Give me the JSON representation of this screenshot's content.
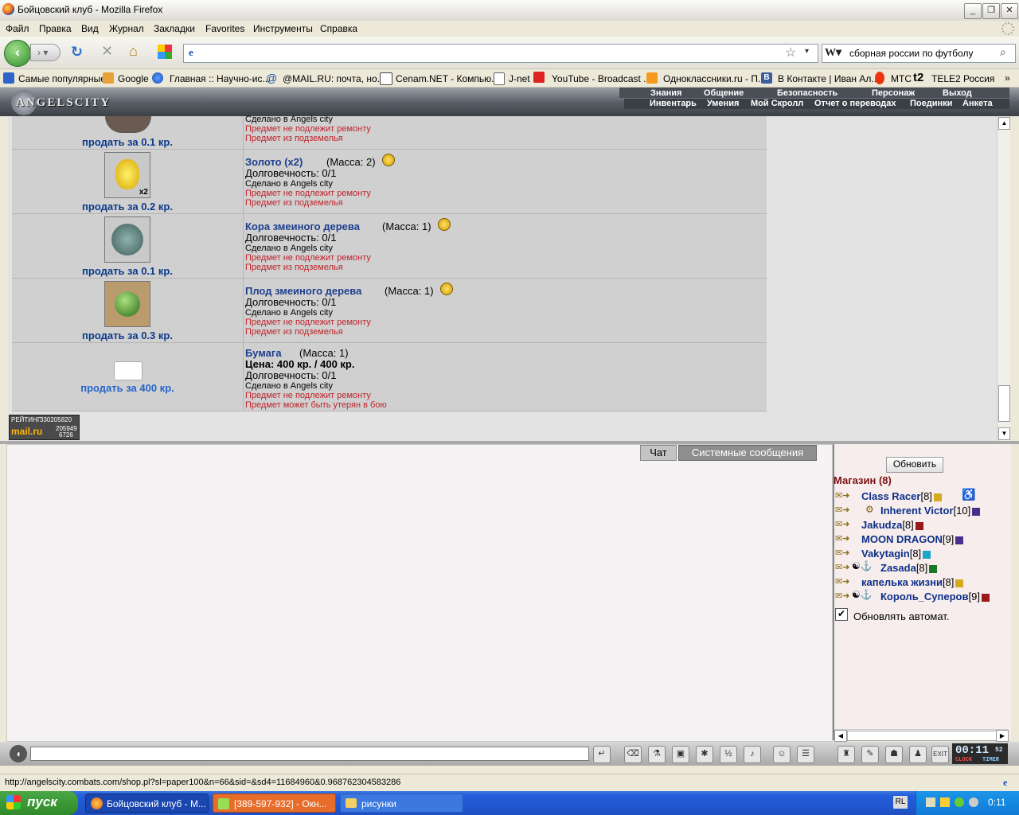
{
  "window": {
    "title": "Бойцовский клуб - Mozilla Firefox"
  },
  "menu": [
    "Файл",
    "Правка",
    "Вид",
    "Журнал",
    "Закладки",
    "Favorites",
    "Инструменты",
    "Справка"
  ],
  "search": {
    "value": "сборная россии по футболу"
  },
  "bookmarks": [
    "Самые популярные",
    "Google",
    "Главная :: Научно-ис...",
    "@MAIL.RU: почта, но...",
    "Cenam.NET - Компью...",
    "J-net",
    "YouTube - Broadcast ...",
    "Одноклассники.ru - П...",
    "В Контакте | Иван Ал...",
    "МТС",
    "TELE2 Россия"
  ],
  "game": {
    "logo": "ANGELSCITY",
    "top_links": [
      "Знания",
      "Общение",
      "Безопасность",
      "Персонаж",
      "Выход"
    ],
    "sub_links": [
      "Инвентарь",
      "Умения",
      "Мой Скролл",
      "Отчет о переводах",
      "Поединки",
      "Анкета"
    ]
  },
  "items": [
    {
      "sell": "продать за 0.1 кр.",
      "made": "Сделано в Angels city",
      "notes": [
        "Предмет не подлежит ремонту",
        "Предмет из подземелья"
      ]
    },
    {
      "sell": "продать за 0.2 кр.",
      "name": "Золото (x2)",
      "mass": "(Масса: 2)",
      "durability": "Долговечность: 0/1",
      "made": "Сделано в Angels city",
      "notes": [
        "Предмет не подлежит ремонту",
        "Предмет из подземелья"
      ],
      "badge": "x2"
    },
    {
      "sell": "продать за 0.1 кр.",
      "name": "Кора змеиного дерева",
      "mass": "(Масса: 1)",
      "durability": "Долговечность: 0/1",
      "made": "Сделано в Angels city",
      "notes": [
        "Предмет не подлежит ремонту",
        "Предмет из подземелья"
      ]
    },
    {
      "sell": "продать за 0.3 кр.",
      "name": "Плод змеиного дерева",
      "mass": "(Масса: 1)",
      "durability": "Долговечность: 0/1",
      "made": "Сделано в Angels city",
      "notes": [
        "Предмет не подлежит ремонту",
        "Предмет из подземелья"
      ]
    },
    {
      "sell": "продать за 400 кр.",
      "name": "Бумага",
      "mass": "(Масса: 1)",
      "price": "Цена: 400 кр. / 400 кр.",
      "durability": "Долговечность: 0/1",
      "made": "Сделано в Angels city",
      "notes": [
        "Предмет не подлежит ремонту",
        "Предмет может быть утерян в бою"
      ]
    }
  ],
  "counter": {
    "label": "РЕЙТИНГ",
    "brand": "mail.ru",
    "n1": "330205820",
    "n2": "205949",
    "n3": "6726"
  },
  "chat": {
    "tabs": [
      "Чат",
      "Системные сообщения"
    ]
  },
  "panel": {
    "refresh": "Обновить",
    "shop_title": "Магазин (8)",
    "users": [
      {
        "name": "Class Racer",
        "level": "[8]"
      },
      {
        "name": "Inherent Victor",
        "level": "[10]"
      },
      {
        "name": "Jakudza",
        "level": "[8]"
      },
      {
        "name": "MOON DRAGON",
        "level": "[9]"
      },
      {
        "name": "Vakytagin",
        "level": "[8]"
      },
      {
        "name": "Zasada",
        "level": "[8]"
      },
      {
        "name": "капелька жизни",
        "level": "[8]"
      },
      {
        "name": "Король_Суперов",
        "level": "[9]"
      }
    ],
    "auto_refresh": "Обновлять автомат."
  },
  "clock": {
    "time": "00:11",
    "sec": "52",
    "l1": "CLOCK",
    "l2": "TIMER"
  },
  "status": "http://angelscity.combats.com/shop.pl?sl=paper100&n=66&sid=&sd4=11684960&0.968762304583286",
  "taskbar": {
    "start": "пуск",
    "tasks": [
      "Бойцовский клуб - M...",
      "[389-597-932] - Окн...",
      "рисунки"
    ],
    "lang": "RL",
    "time": "0:11"
  }
}
